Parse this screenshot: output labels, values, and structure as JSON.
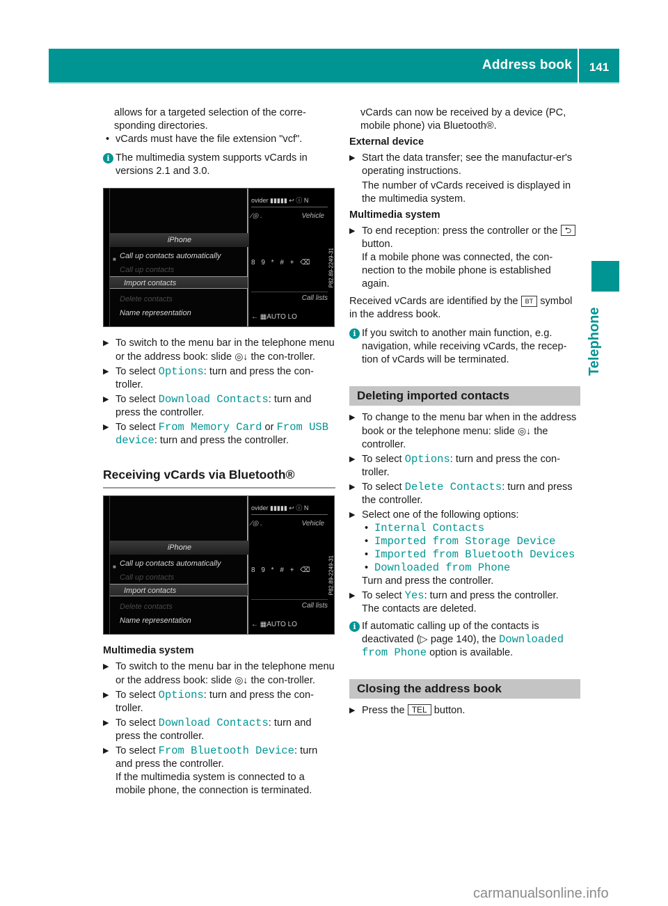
{
  "header": {
    "title": "Address book",
    "page_number": "141",
    "accent_color": "#009593"
  },
  "side_tab": {
    "label": "Telephone"
  },
  "left": {
    "intro_cont": "allows for a targeted selection of the corre-sponding directories.",
    "bullet_vcf": "vCards must have the file extension \"vcf\".",
    "note_versions": "The multimedia system supports vCards in versions 2.1 and 3.0.",
    "screen": {
      "top_status": "ovider ▮▮▮▮▮ ↩ ⓘ N",
      "nav_partial": "∕◎ .",
      "vehicle": "Vehicle",
      "menu_title": "iPhone",
      "items": [
        "Call up contacts automatically",
        "Call up contacts",
        "Import contacts",
        "Delete contacts",
        "Name representation"
      ],
      "keys": "8 9 * # + ⌫",
      "call_lists": "Call lists",
      "bottom": "← ▦AUTO   LO",
      "code": "P82.89-2249-31"
    },
    "steps1": {
      "s1": "To switch to the menu bar in the telephone menu or the address book: slide",
      "s1_ctrl": "◎↓",
      "s1_end": "the con-troller.",
      "s2_pre": "To select",
      "s2_code": "Options",
      "s2_post": ": turn and press the con-troller.",
      "s3_pre": "To select",
      "s3_code": "Download Contacts",
      "s3_post": ": turn and press the controller.",
      "s4_pre": "To select",
      "s4_code1": "From Memory Card",
      "s4_or": "or",
      "s4_code2": "From USB device",
      "s4_post": ": turn and press the controller."
    },
    "section_heading": "Receiving vCards via Bluetooth®",
    "multimedia_heading": "Multimedia system",
    "steps2": {
      "s1": "To switch to the menu bar in the telephone menu or the address book: slide",
      "s1_ctrl": "◎↓",
      "s1_end": "the con-troller.",
      "s2_pre": "To select",
      "s2_code": "Options",
      "s2_post": ": turn and press the con-troller.",
      "s3_pre": "To select",
      "s3_code": "Download Contacts",
      "s3_post": ": turn and press the controller.",
      "s4_pre": "To select",
      "s4_code": "From Bluetooth Device",
      "s4_post": ": turn and press the controller.",
      "s4_extra": "If the multimedia system is connected to a mobile phone, the connection is terminated."
    }
  },
  "right": {
    "intro": "vCards can now be received by a device (PC, mobile phone) via Bluetooth®.",
    "external_heading": "External device",
    "ext_step": "Start the data transfer; see the manufactur-er's operating instructions.",
    "ext_note": "The number of vCards received is displayed in the multimedia system.",
    "mm_heading": "Multimedia system",
    "mm_step_pre": "To end reception: press the controller or the",
    "mm_step_btn": "⮌",
    "mm_step_post": "button.",
    "mm_step_extra": "If a mobile phone was connected, the con-nection to the mobile phone is established again.",
    "received_pre": "Received vCards are identified by the",
    "received_symbol": "BT",
    "received_post": "symbol in the address book.",
    "note_switch": "If you switch to another main function, e.g. navigation, while receiving vCards, the recep-tion of vCards will be terminated.",
    "deleting_heading": "Deleting imported contacts",
    "del": {
      "s1": "To change to the menu bar when in the address book or the telephone menu: slide",
      "s1_ctrl": "◎↓",
      "s1_end": "the controller.",
      "s2_pre": "To select",
      "s2_code": "Options",
      "s2_post": ": turn and press the con-troller.",
      "s3_pre": "To select",
      "s3_code": "Delete Contacts",
      "s3_post": ": turn and press the controller.",
      "s4": "Select one of the following options:",
      "options": [
        "Internal Contacts",
        "Imported from Storage Device",
        "Imported from Bluetooth Devices",
        "Downloaded from Phone"
      ],
      "s4_post": "Turn and press the controller.",
      "s5_pre": "To select",
      "s5_code": "Yes",
      "s5_post": ": turn and press the controller.",
      "s5_extra": "The contacts are deleted.",
      "note_pre": "If automatic calling up of the contacts is deactivated (▷ page 140), the",
      "note_code": "Downloaded from Phone",
      "note_post": "option is available."
    },
    "closing_heading": "Closing the address book",
    "closing_pre": "Press the",
    "closing_btn": "TEL",
    "closing_post": "button."
  },
  "watermark": "carmanualsonline.info"
}
